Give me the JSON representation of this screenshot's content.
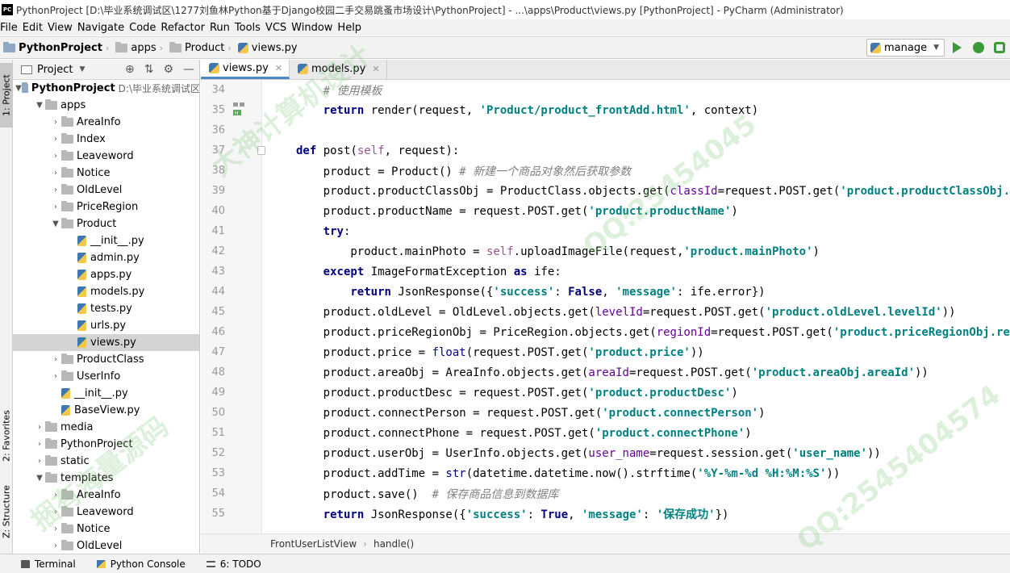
{
  "window": {
    "app_icon_text": "PC",
    "title": "PythonProject [D:\\毕业系统调试区\\1277刘鱼林Python基于Django校园二手交易跳蚤市场设计\\PythonProject] - ...\\apps\\Product\\views.py [PythonProject] - PyCharm (Administrator)"
  },
  "menu": [
    "File",
    "Edit",
    "View",
    "Navigate",
    "Code",
    "Refactor",
    "Run",
    "Tools",
    "VCS",
    "Window",
    "Help"
  ],
  "nav": {
    "crumbs": [
      "PythonProject",
      "apps",
      "Product",
      "views.py"
    ],
    "run_config": "manage"
  },
  "left_strip": {
    "project_tab": "1: Project",
    "favorites_tab": "2: Favorites",
    "structure_tab": "Z: Structure"
  },
  "project_panel": {
    "header": "Project",
    "tree": [
      {
        "label": "PythonProject",
        "hint": "D:\\毕业系统调试区",
        "depth": 0,
        "type": "folder",
        "expanded": true,
        "bold": true
      },
      {
        "label": "apps",
        "depth": 1,
        "type": "folder",
        "expanded": true
      },
      {
        "label": "AreaInfo",
        "depth": 2,
        "type": "folder",
        "expanded": false
      },
      {
        "label": "Index",
        "depth": 2,
        "type": "folder",
        "expanded": false
      },
      {
        "label": "Leaveword",
        "depth": 2,
        "type": "folder",
        "expanded": false
      },
      {
        "label": "Notice",
        "depth": 2,
        "type": "folder",
        "expanded": false
      },
      {
        "label": "OldLevel",
        "depth": 2,
        "type": "folder",
        "expanded": false
      },
      {
        "label": "PriceRegion",
        "depth": 2,
        "type": "folder",
        "expanded": false
      },
      {
        "label": "Product",
        "depth": 2,
        "type": "folder",
        "expanded": true
      },
      {
        "label": "__init__.py",
        "depth": 3,
        "type": "file"
      },
      {
        "label": "admin.py",
        "depth": 3,
        "type": "file"
      },
      {
        "label": "apps.py",
        "depth": 3,
        "type": "file"
      },
      {
        "label": "models.py",
        "depth": 3,
        "type": "file"
      },
      {
        "label": "tests.py",
        "depth": 3,
        "type": "file"
      },
      {
        "label": "urls.py",
        "depth": 3,
        "type": "file"
      },
      {
        "label": "views.py",
        "depth": 3,
        "type": "file",
        "selected": true
      },
      {
        "label": "ProductClass",
        "depth": 2,
        "type": "folder",
        "expanded": false
      },
      {
        "label": "UserInfo",
        "depth": 2,
        "type": "folder",
        "expanded": false
      },
      {
        "label": "__init__.py",
        "depth": 2,
        "type": "file"
      },
      {
        "label": "BaseView.py",
        "depth": 2,
        "type": "file"
      },
      {
        "label": "media",
        "depth": 1,
        "type": "folder",
        "expanded": false
      },
      {
        "label": "PythonProject",
        "depth": 1,
        "type": "folder",
        "expanded": false
      },
      {
        "label": "static",
        "depth": 1,
        "type": "folder",
        "expanded": false
      },
      {
        "label": "templates",
        "depth": 1,
        "type": "folder",
        "expanded": true
      },
      {
        "label": "AreaInfo",
        "depth": 2,
        "type": "folder",
        "expanded": false
      },
      {
        "label": "Leaveword",
        "depth": 2,
        "type": "folder",
        "expanded": false
      },
      {
        "label": "Notice",
        "depth": 2,
        "type": "folder",
        "expanded": false
      },
      {
        "label": "OldLevel",
        "depth": 2,
        "type": "folder",
        "expanded": false
      }
    ]
  },
  "editor": {
    "tabs": [
      {
        "label": "views.py",
        "active": true
      },
      {
        "label": "models.py",
        "active": false
      }
    ],
    "lines": [
      {
        "n": "34",
        "indent": 8,
        "parts": [
          [
            "cm",
            "# 使用模板"
          ]
        ]
      },
      {
        "n": "35",
        "indent": 8,
        "parts": [
          [
            "kw",
            "return "
          ],
          [
            "",
            "render(request, "
          ],
          [
            "str",
            "'Product/product_frontAdd.html'"
          ],
          [
            "",
            ", context)"
          ]
        ]
      },
      {
        "n": "36",
        "indent": 0,
        "parts": []
      },
      {
        "n": "37",
        "indent": 4,
        "fold": true,
        "parts": [
          [
            "kw",
            "def "
          ],
          [
            "fn",
            "post"
          ],
          [
            "",
            "("
          ],
          [
            "sf",
            "self"
          ],
          [
            "",
            ", request):"
          ]
        ]
      },
      {
        "n": "38",
        "indent": 8,
        "parts": [
          [
            "",
            "product = Product() "
          ],
          [
            "cm",
            "# 新建一个商品对象然后获取参数"
          ]
        ]
      },
      {
        "n": "39",
        "indent": 8,
        "parts": [
          [
            "",
            "product.productClassObj = ProductClass.objects.get("
          ],
          [
            "pr",
            "classId"
          ],
          [
            "",
            "=request.POST.get("
          ],
          [
            "str",
            "'product.productClassObj.classId'"
          ],
          [
            "",
            "))"
          ]
        ]
      },
      {
        "n": "40",
        "indent": 8,
        "parts": [
          [
            "",
            "product.productName = request.POST.get("
          ],
          [
            "str",
            "'product.productName'"
          ],
          [
            "",
            ")"
          ]
        ]
      },
      {
        "n": "41",
        "indent": 8,
        "parts": [
          [
            "kw",
            "try"
          ],
          [
            "",
            ":"
          ]
        ]
      },
      {
        "n": "42",
        "indent": 12,
        "parts": [
          [
            "",
            "product.mainPhoto = "
          ],
          [
            "sf",
            "self"
          ],
          [
            "",
            ".uploadImageFile(request,"
          ],
          [
            "str",
            "'product.mainPhoto'"
          ],
          [
            "",
            ")"
          ]
        ]
      },
      {
        "n": "43",
        "indent": 8,
        "parts": [
          [
            "kw",
            "except "
          ],
          [
            "",
            "ImageFormatException "
          ],
          [
            "kw",
            "as "
          ],
          [
            "",
            "ife:"
          ]
        ]
      },
      {
        "n": "44",
        "indent": 12,
        "parts": [
          [
            "kw",
            "return "
          ],
          [
            "",
            "JsonResponse({"
          ],
          [
            "str",
            "'success'"
          ],
          [
            "",
            ": "
          ],
          [
            "kw",
            "False"
          ],
          [
            "",
            ", "
          ],
          [
            "str",
            "'message'"
          ],
          [
            "",
            ": ife.error})"
          ]
        ]
      },
      {
        "n": "45",
        "indent": 8,
        "parts": [
          [
            "",
            "product.oldLevel = OldLevel.objects.get("
          ],
          [
            "pr",
            "levelId"
          ],
          [
            "",
            "=request.POST.get("
          ],
          [
            "str",
            "'product.oldLevel.levelId'"
          ],
          [
            "",
            "))"
          ]
        ]
      },
      {
        "n": "46",
        "indent": 8,
        "parts": [
          [
            "",
            "product.priceRegionObj = PriceRegion.objects.get("
          ],
          [
            "pr",
            "regionId"
          ],
          [
            "",
            "=request.POST.get("
          ],
          [
            "str",
            "'product.priceRegionObj.regionId'"
          ],
          [
            "",
            "))"
          ]
        ]
      },
      {
        "n": "47",
        "indent": 8,
        "parts": [
          [
            "",
            "product.price = "
          ],
          [
            "bi",
            "float"
          ],
          [
            "",
            "(request.POST.get("
          ],
          [
            "str",
            "'product.price'"
          ],
          [
            "",
            "))"
          ]
        ]
      },
      {
        "n": "48",
        "indent": 8,
        "parts": [
          [
            "",
            "product.areaObj = AreaInfo.objects.get("
          ],
          [
            "pr",
            "areaId"
          ],
          [
            "",
            "=request.POST.get("
          ],
          [
            "str",
            "'product.areaObj.areaId'"
          ],
          [
            "",
            "))"
          ]
        ]
      },
      {
        "n": "49",
        "indent": 8,
        "parts": [
          [
            "",
            "product.productDesc = request.POST.get("
          ],
          [
            "str",
            "'product.productDesc'"
          ],
          [
            "",
            ")"
          ]
        ]
      },
      {
        "n": "50",
        "indent": 8,
        "parts": [
          [
            "",
            "product.connectPerson = request.POST.get("
          ],
          [
            "str",
            "'product.connectPerson'"
          ],
          [
            "",
            ")"
          ]
        ]
      },
      {
        "n": "51",
        "indent": 8,
        "parts": [
          [
            "",
            "product.connectPhone = request.POST.get("
          ],
          [
            "str",
            "'product.connectPhone'"
          ],
          [
            "",
            ")"
          ]
        ]
      },
      {
        "n": "52",
        "indent": 8,
        "parts": [
          [
            "",
            "product.userObj = UserInfo.objects.get("
          ],
          [
            "pr",
            "user_name"
          ],
          [
            "",
            "=request.session.get("
          ],
          [
            "str",
            "'user_name'"
          ],
          [
            "",
            "))"
          ]
        ]
      },
      {
        "n": "53",
        "indent": 8,
        "parts": [
          [
            "",
            "product.addTime = "
          ],
          [
            "bi",
            "str"
          ],
          [
            "",
            "(datetime.datetime.now().strftime("
          ],
          [
            "str",
            "'%Y-%m-%d %H:%M:%S'"
          ],
          [
            "",
            "))"
          ]
        ]
      },
      {
        "n": "54",
        "indent": 8,
        "parts": [
          [
            "",
            "product.save()  "
          ],
          [
            "cm",
            "# 保存商品信息到数据库"
          ]
        ]
      },
      {
        "n": "55",
        "indent": 8,
        "parts": [
          [
            "kw",
            "return "
          ],
          [
            "",
            "JsonResponse({"
          ],
          [
            "str",
            "'success'"
          ],
          [
            "",
            ": "
          ],
          [
            "kw",
            "True"
          ],
          [
            "",
            ", "
          ],
          [
            "str",
            "'message'"
          ],
          [
            "",
            ": "
          ],
          [
            "str",
            "'保存成功'"
          ],
          [
            "",
            "})"
          ]
        ]
      }
    ],
    "breadcrumb": [
      "FrontUserListView",
      "handle()"
    ]
  },
  "bottom_tabs": [
    "Terminal",
    "Python Console",
    "6: TODO"
  ],
  "watermark": [
    "大神计算机设计",
    "QQ:25454045",
    "QQ:2545404574",
    "捆有海量源码"
  ]
}
